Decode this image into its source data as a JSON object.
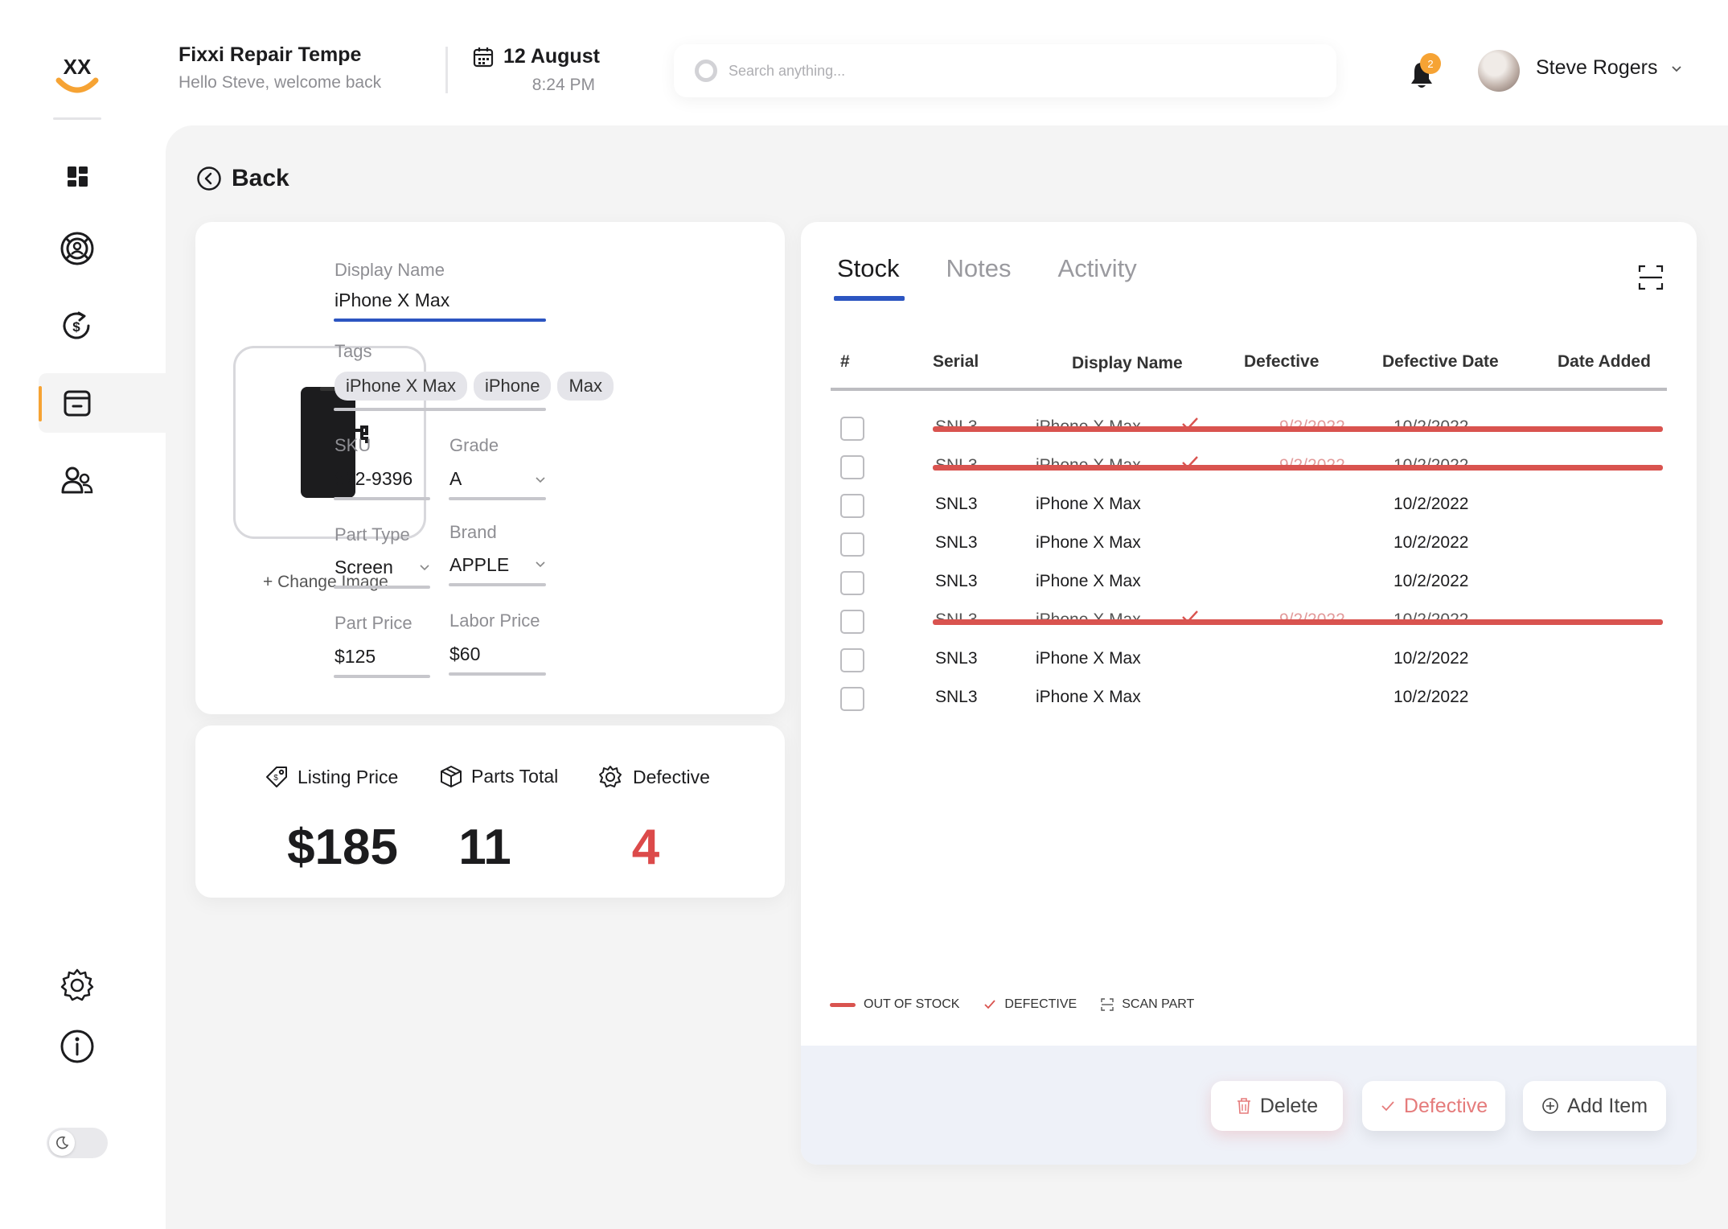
{
  "app": {
    "logo_text": "XX"
  },
  "header": {
    "shop_name": "Fixxi Repair Tempe",
    "welcome": "Hello Steve, welcome back",
    "date": "12 August",
    "time": "8:24 PM",
    "search_placeholder": "Search anything...",
    "notification_count": "2",
    "user_name": "Steve Rogers"
  },
  "sidebar": {
    "items": [
      {
        "name": "dashboard",
        "icon": "grid-icon"
      },
      {
        "name": "repairs",
        "icon": "lifebuoy-icon"
      },
      {
        "name": "sales",
        "icon": "dollar-refresh-icon"
      },
      {
        "name": "inventory",
        "icon": "box-icon",
        "active": true
      },
      {
        "name": "customers",
        "icon": "users-icon"
      }
    ],
    "bottom": [
      {
        "name": "settings",
        "icon": "gear-icon"
      },
      {
        "name": "info",
        "icon": "info-icon"
      }
    ]
  },
  "back_label": "Back",
  "detail": {
    "change_image": "+ Change Image",
    "display_name_label": "Display Name",
    "display_name": "iPhone X Max",
    "tags_label": "Tags",
    "tags": [
      "iPhone X Max",
      "iPhone",
      "Max"
    ],
    "sku_label": "SKU",
    "sku": "822-9396",
    "grade_label": "Grade",
    "grade": "A",
    "part_type_label": "Part Type",
    "part_type": "Screen",
    "brand_label": "Brand",
    "brand": "APPLE",
    "part_price_label": "Part Price",
    "part_price": "$125",
    "labor_price_label": "Labor Price",
    "labor_price": "$60"
  },
  "stats": {
    "listing_price_label": "Listing Price",
    "listing_price": "$185",
    "parts_total_label": "Parts Total",
    "parts_total": "11",
    "defective_label": "Defective",
    "defective": "4"
  },
  "stock": {
    "tabs": [
      "Stock",
      "Notes",
      "Activity"
    ],
    "columns": [
      "#",
      "Serial",
      "Display Name",
      "Defective",
      "Defective Date",
      "Date Added"
    ],
    "rows": [
      {
        "serial": "SNL3",
        "name": "iPhone X Max",
        "defective": true,
        "defective_date": "9/2/2022",
        "date_added": "10/2/2022",
        "out_of_stock": true
      },
      {
        "serial": "SNL3",
        "name": "iPhone X Max",
        "defective": true,
        "defective_date": "9/2/2022",
        "date_added": "10/2/2022",
        "out_of_stock": true
      },
      {
        "serial": "SNL3",
        "name": "iPhone X Max",
        "defective": false,
        "defective_date": "",
        "date_added": "10/2/2022",
        "out_of_stock": false
      },
      {
        "serial": "SNL3",
        "name": "iPhone X Max",
        "defective": false,
        "defective_date": "",
        "date_added": "10/2/2022",
        "out_of_stock": false
      },
      {
        "serial": "SNL3",
        "name": "iPhone X Max",
        "defective": false,
        "defective_date": "",
        "date_added": "10/2/2022",
        "out_of_stock": false
      },
      {
        "serial": "SNL3",
        "name": "iPhone X Max",
        "defective": true,
        "defective_date": "9/2/2022",
        "date_added": "10/2/2022",
        "out_of_stock": true
      },
      {
        "serial": "SNL3",
        "name": "iPhone X Max",
        "defective": false,
        "defective_date": "",
        "date_added": "10/2/2022",
        "out_of_stock": false
      },
      {
        "serial": "SNL3",
        "name": "iPhone X Max",
        "defective": false,
        "defective_date": "",
        "date_added": "10/2/2022",
        "out_of_stock": false
      }
    ],
    "legend": {
      "out_of_stock": "OUT OF STOCK",
      "defective": "DEFECTIVE",
      "scan_part": "SCAN PART"
    },
    "buttons": {
      "delete": "Delete",
      "defective": "Defective",
      "add_item": "Add Item"
    }
  },
  "colors": {
    "accent_blue": "#2c55c1",
    "accent_orange": "#f6a334",
    "danger_red": "#d9534f"
  }
}
